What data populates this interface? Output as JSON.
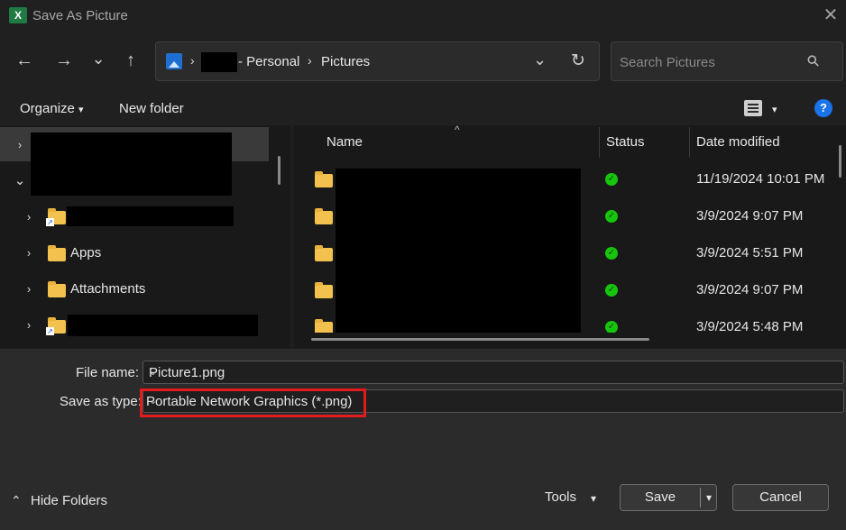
{
  "window": {
    "title": "Save As Picture",
    "app_icon_letter": "X",
    "close_glyph": "✕"
  },
  "nav": {
    "back_glyph": "←",
    "forward_glyph": "→",
    "recent_glyph": "⌄",
    "up_glyph": "↑",
    "breadcrumb": {
      "segment_personal": "- Personal",
      "segment_pictures": "Pictures",
      "separator": "›"
    },
    "dropdown_glyph": "⌄",
    "refresh_glyph": "↻"
  },
  "search": {
    "placeholder": "Search Pictures",
    "icon_glyph": "⚲"
  },
  "commandbar": {
    "organize": "Organize",
    "organize_caret": "▾",
    "new_folder": "New folder",
    "view_caret": "▾",
    "help": "?"
  },
  "tree": {
    "items": [
      {
        "label": "",
        "chevron": "›"
      },
      {
        "label": "",
        "chevron": "⌄"
      },
      {
        "label": "",
        "chevron": "›"
      },
      {
        "label": "Apps",
        "chevron": "›"
      },
      {
        "label": "Attachments",
        "chevron": "›"
      },
      {
        "label": "",
        "chevron": "›"
      }
    ]
  },
  "files": {
    "columns": {
      "name": "Name",
      "status": "Status",
      "date": "Date modified",
      "sort_glyph": "^"
    },
    "rows": [
      {
        "date": "11/19/2024 10:01 PM",
        "status": "✓"
      },
      {
        "date": "3/9/2024 9:07 PM",
        "status": "✓"
      },
      {
        "date": "3/9/2024 5:51 PM",
        "status": "✓"
      },
      {
        "date": "3/9/2024 9:07 PM",
        "status": "✓"
      },
      {
        "date": "3/9/2024 5:48 PM",
        "status": "✓"
      }
    ]
  },
  "form": {
    "file_name_label": "File name:",
    "file_name_value": "Picture1.png",
    "save_type_label": "Save as type:",
    "save_type_value": "Portable Network Graphics (*.png)",
    "dropdown_glyph": "⌄"
  },
  "footer": {
    "hide_folders": "Hide Folders",
    "hide_glyph": "⌃",
    "tools": "Tools",
    "tools_caret": "▾",
    "save": "Save",
    "save_caret": "▾",
    "cancel": "Cancel"
  },
  "colors": {
    "highlight_border": "#e21c1c",
    "status_ok": "#16c60c",
    "help_blue": "#1a73e8",
    "folder": "#f2c14e"
  }
}
